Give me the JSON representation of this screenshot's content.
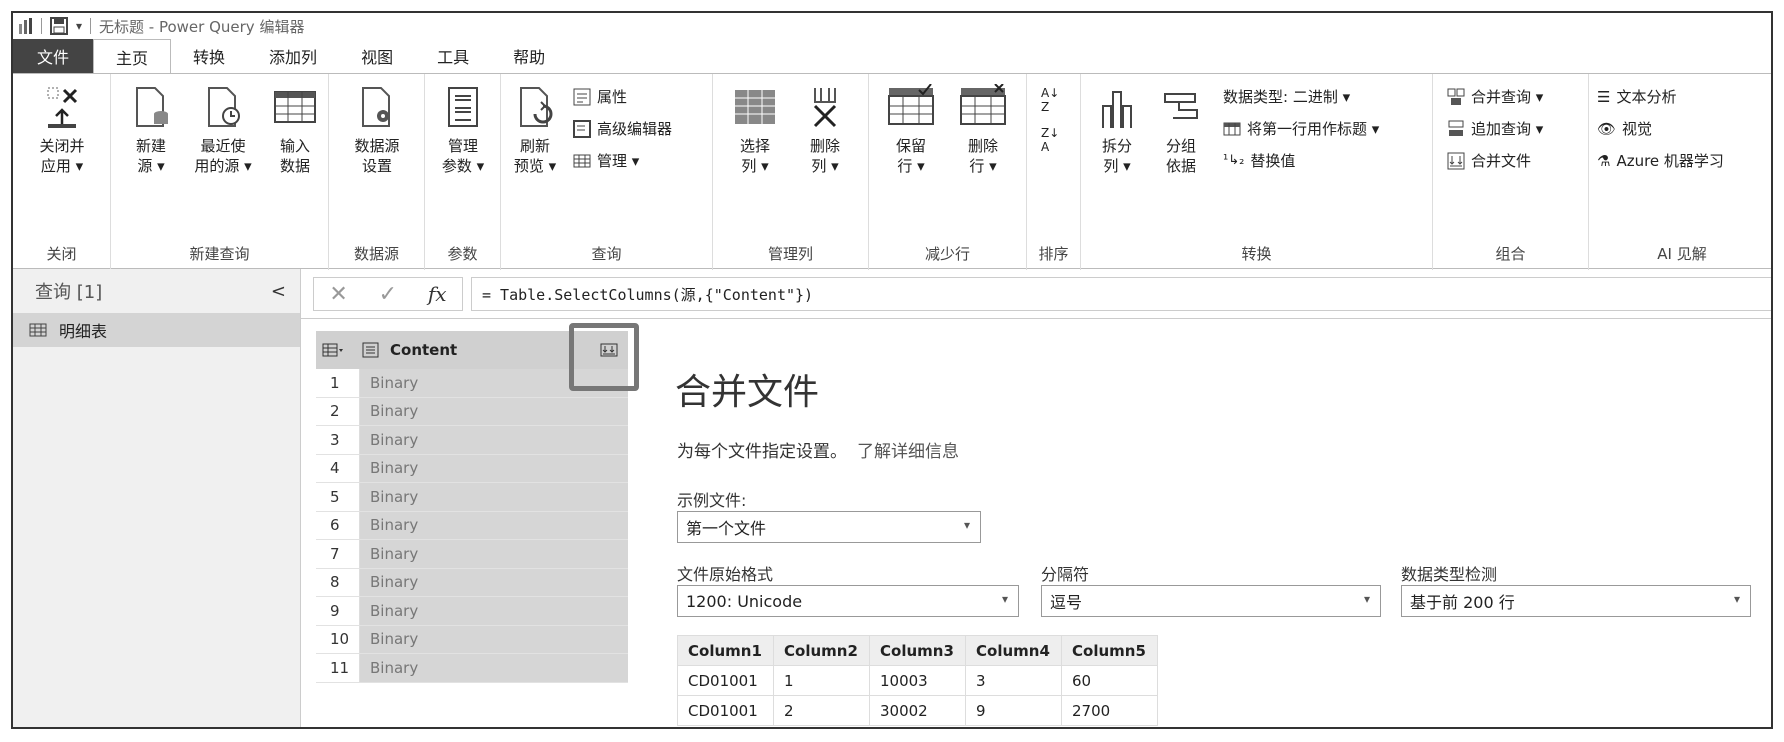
{
  "titlebar": {
    "title": "无标题 - Power Query 编辑器"
  },
  "tabs": [
    "文件",
    "主页",
    "转换",
    "添加列",
    "视图",
    "工具",
    "帮助"
  ],
  "ribbon": {
    "close": {
      "btn": [
        "关闭并",
        "应用 ▾"
      ],
      "label": "关闭"
    },
    "new_query": {
      "new_source": [
        "新建",
        "源 ▾"
      ],
      "recent": [
        "最近使",
        "用的源 ▾"
      ],
      "enter": [
        "输入",
        "数据"
      ],
      "label": "新建查询"
    },
    "datasource": {
      "btn": [
        "数据源",
        "设置"
      ],
      "label": "数据源"
    },
    "params": {
      "btn": [
        "管理",
        "参数 ▾"
      ],
      "label": "参数"
    },
    "query": {
      "refresh": [
        "刷新",
        "预览 ▾"
      ],
      "properties": "属性",
      "advanced": "高级编辑器",
      "manage": "管理 ▾",
      "label": "查询"
    },
    "manage_cols": {
      "choose": [
        "选择",
        "列 ▾"
      ],
      "remove": [
        "删除",
        "列 ▾"
      ],
      "label": "管理列"
    },
    "reduce_rows": {
      "keep": [
        "保留",
        "行 ▾"
      ],
      "remove": [
        "删除",
        "行 ▾"
      ],
      "label": "减少行"
    },
    "sort": {
      "label": "排序"
    },
    "transform": {
      "split": [
        "拆分",
        "列 ▾"
      ],
      "group": [
        "分组",
        "依据"
      ],
      "datatype": "数据类型: 二进制 ▾",
      "first_row": "将第一行用作标题 ▾",
      "replace": "替换值",
      "label": "转换"
    },
    "combine": {
      "merge": "合并查询 ▾",
      "append": "追加查询 ▾",
      "combine_files": "合并文件",
      "label": "组合"
    },
    "ai": {
      "text": "文本分析",
      "vision": "视觉",
      "azure": "Azure 机器学习",
      "label": "AI 见解"
    }
  },
  "queries": {
    "header": "查询 [1]",
    "items": [
      "明细表"
    ]
  },
  "formula": {
    "text": "= Table.SelectColumns(源,{\"Content\"})"
  },
  "grid": {
    "column": "Content",
    "rows": [
      {
        "n": "1",
        "v": "Binary"
      },
      {
        "n": "2",
        "v": "Binary"
      },
      {
        "n": "3",
        "v": "Binary"
      },
      {
        "n": "4",
        "v": "Binary"
      },
      {
        "n": "5",
        "v": "Binary"
      },
      {
        "n": "6",
        "v": "Binary"
      },
      {
        "n": "7",
        "v": "Binary"
      },
      {
        "n": "8",
        "v": "Binary"
      },
      {
        "n": "9",
        "v": "Binary"
      },
      {
        "n": "10",
        "v": "Binary"
      },
      {
        "n": "11",
        "v": "Binary"
      }
    ]
  },
  "combine": {
    "title": "合并文件",
    "desc": "为每个文件指定设置。",
    "learn_more": "了解详细信息",
    "sample_label": "示例文件:",
    "sample_value": "第一个文件",
    "origin_label": "文件原始格式",
    "origin_value": "1200: Unicode",
    "delim_label": "分隔符",
    "delim_value": "逗号",
    "detect_label": "数据类型检测",
    "detect_value": "基于前 200 行",
    "table": {
      "headers": [
        "Column1",
        "Column2",
        "Column3",
        "Column4",
        "Column5"
      ],
      "rows": [
        [
          "CD01001",
          "1",
          "10003",
          "3",
          "60"
        ],
        [
          "CD01001",
          "2",
          "30002",
          "9",
          "2700"
        ]
      ]
    }
  }
}
